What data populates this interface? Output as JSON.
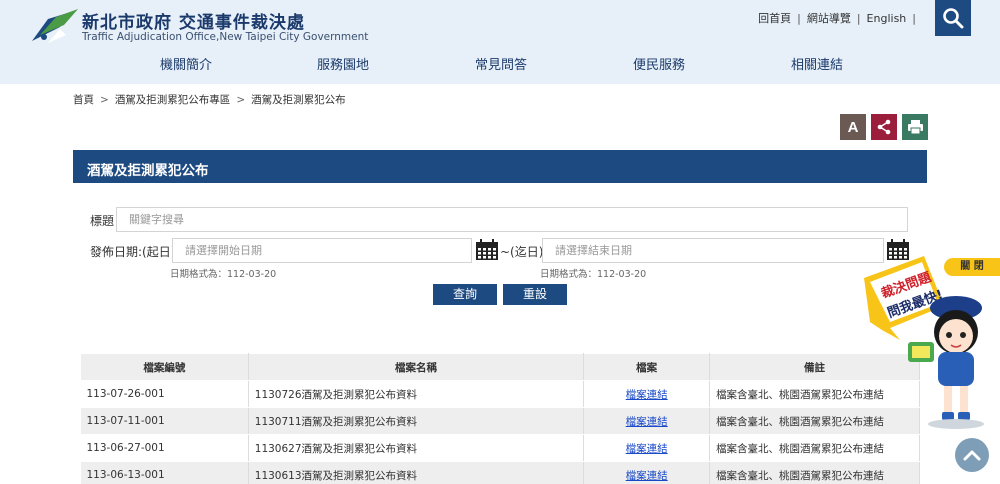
{
  "header": {
    "title": "新北市政府 交通事件裁決處",
    "subtitle": "Traffic Adjudication Office,New Taipei City Government",
    "toplinks": [
      "回首頁",
      "網站導覽",
      "English"
    ]
  },
  "nav": [
    "機關簡介",
    "服務園地",
    "常見問答",
    "便民服務",
    "相關連結"
  ],
  "breadcrumb": [
    "首頁",
    "酒駕及拒測累犯公布專區",
    "酒駕及拒測累犯公布"
  ],
  "tools": {
    "font_label": "A"
  },
  "section_title": "酒駕及拒測累犯公布",
  "form": {
    "title_label": "標題",
    "title_placeholder": "關鍵字搜尋",
    "date_label": "發佈日期:(起日)",
    "start_placeholder": "請選擇開始日期",
    "end_label": "~(迄日)",
    "end_placeholder": "請選擇結束日期",
    "date_hint": "日期格式為：112-03-20",
    "query_label": "查詢",
    "reset_label": "重設"
  },
  "table": {
    "headers": [
      "檔案編號",
      "檔案名稱",
      "檔案",
      "備註"
    ],
    "rows": [
      [
        "113-07-26-001",
        "1130726酒駕及拒測累犯公布資料",
        "檔案連結",
        "檔案含臺北、桃園酒駕累犯公布連結"
      ],
      [
        "113-07-11-001",
        "1130711酒駕及拒測累犯公布資料",
        "檔案連結",
        "檔案含臺北、桃園酒駕累犯公布連結"
      ],
      [
        "113-06-27-001",
        "1130627酒駕及拒測累犯公布資料",
        "檔案連結",
        "檔案含臺北、桃園酒駕累犯公布連結"
      ],
      [
        "113-06-13-001",
        "1130613酒駕及拒測累犯公布資料",
        "檔案連結",
        "檔案含臺北、桃園酒駕累犯公布連結"
      ]
    ]
  },
  "mascot": {
    "close_label": "關 閉",
    "line1": "裁決問題",
    "line2": "問我最快!"
  },
  "colors": {
    "primary": "#1d4a80",
    "header_bg": "#e7f0f8",
    "accent_yellow": "#f7c417"
  },
  "icons": [
    "search-icon",
    "calendar-icon",
    "share-icon",
    "print-icon",
    "chevron-up-icon"
  ]
}
